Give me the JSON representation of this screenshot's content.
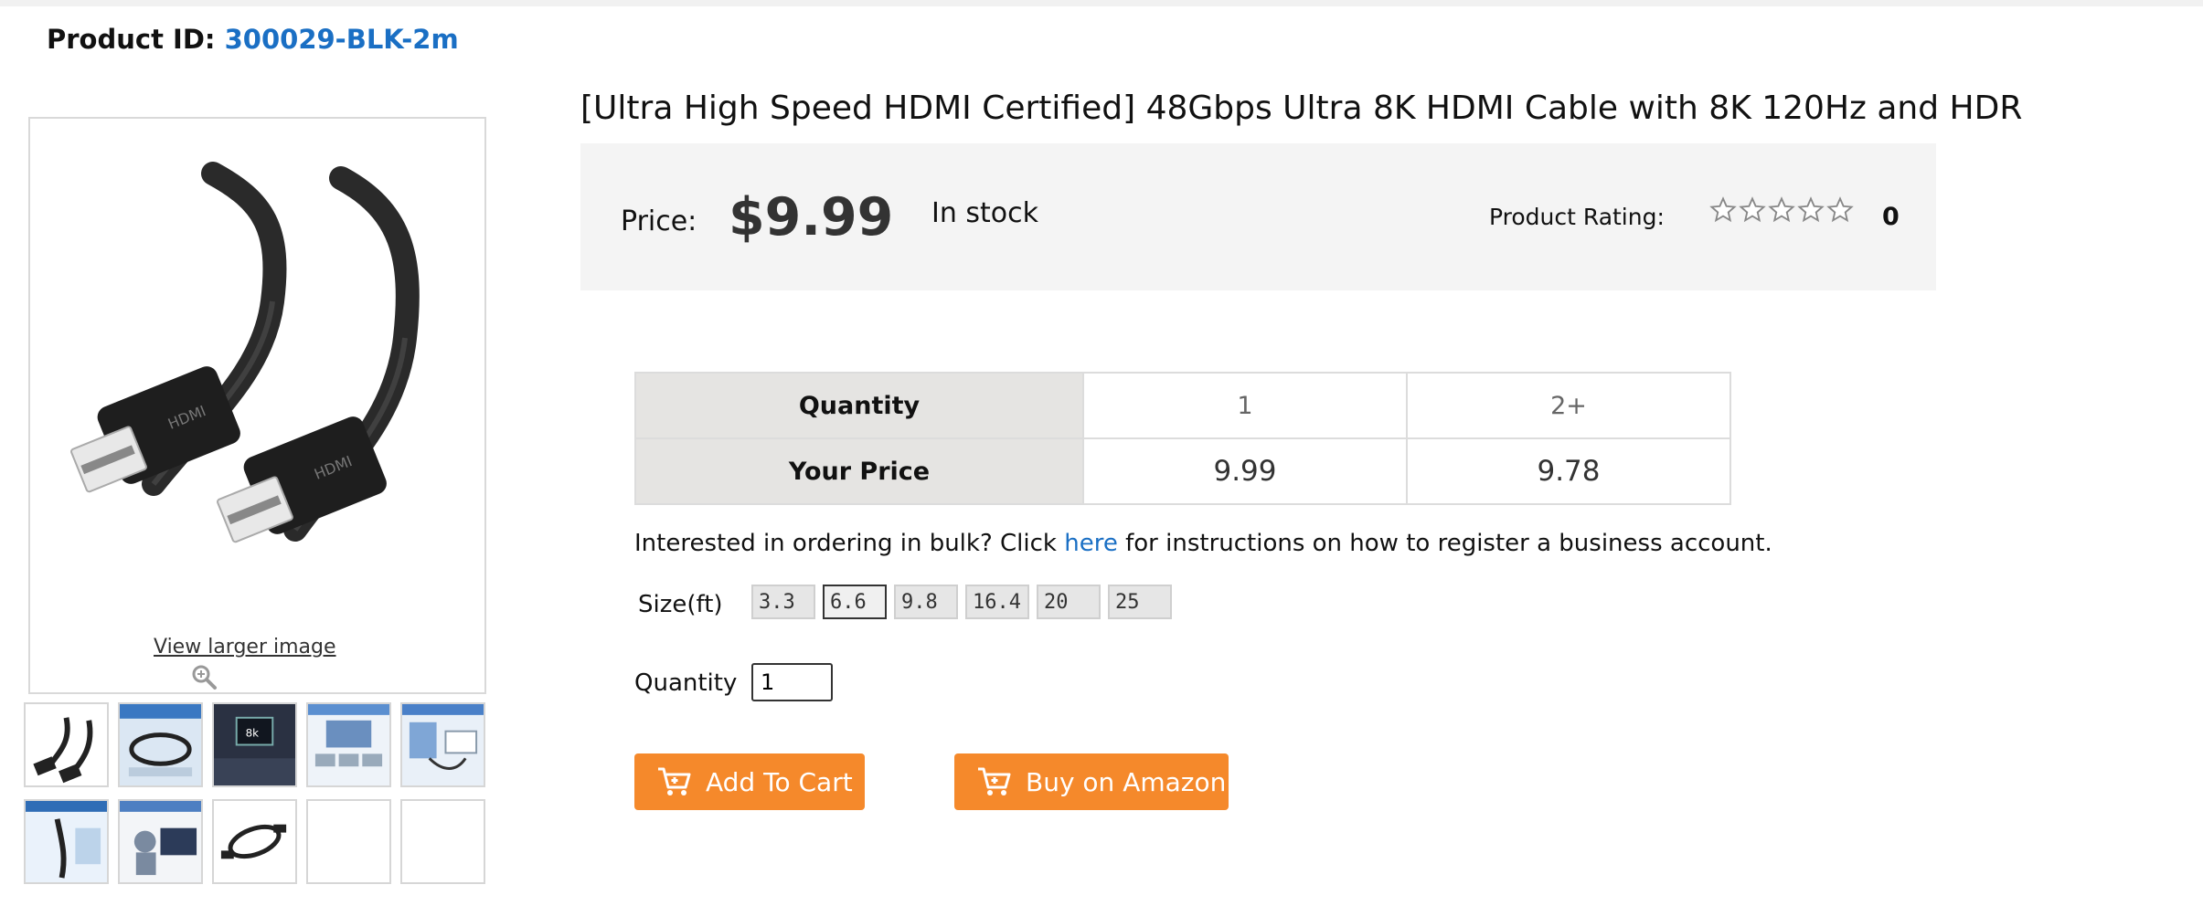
{
  "product": {
    "id_label": "Product ID:",
    "id_value": "300029-BLK-2m",
    "title": "[Ultra High Speed HDMI Certified] 48Gbps Ultra 8K HDMI Cable with 8K 120Hz and HDR",
    "price_label": "Price:",
    "price": "$9.99",
    "stock": "In stock",
    "rating_label": "Product Rating:",
    "rating_stars": 0,
    "rating_count": "0",
    "view_larger": "View larger image"
  },
  "pricing_table": {
    "row1_header": "Quantity",
    "row2_header": "Your Price",
    "quantities": [
      "1",
      "2+"
    ],
    "prices": [
      "9.99",
      "9.78"
    ]
  },
  "bulk": {
    "prefix": "Interested in ordering in bulk? Click",
    "link": "here",
    "suffix": "for instructions on how to register a business account."
  },
  "size": {
    "label": "Size(ft)",
    "options": [
      "3.3",
      "6.6",
      "9.8",
      "16.4",
      "20",
      "25"
    ],
    "selected": "6.6"
  },
  "quantity": {
    "label": "Quantity",
    "value": "1"
  },
  "buttons": {
    "add_to_cart": "Add To Cart",
    "buy_amazon": "Buy on Amazon"
  },
  "colors": {
    "accent": "#f5892b",
    "link": "#1a6fc4"
  }
}
